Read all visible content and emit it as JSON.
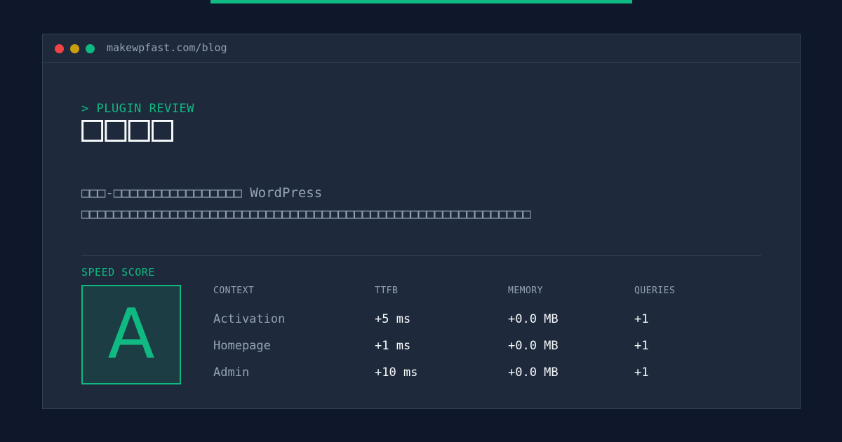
{
  "browser": {
    "url": "makewpfast.com/blog"
  },
  "article": {
    "kicker": "> PLUGIN REVIEW",
    "title": "□□□□",
    "description": "□□□-□□□□□□□□□□□□□□□□ WordPress □□□□□□□□□□□□□□□□□□□□□□□□□□□□□□□□□□□□□□□□□□□□□□□□□□□□□□□□"
  },
  "speed": {
    "label": "SPEED SCORE",
    "grade": "A"
  },
  "table": {
    "headers": [
      "CONTEXT",
      "TTFB",
      "MEMORY",
      "QUERIES"
    ],
    "rows": [
      [
        "Activation",
        "+5 ms",
        "+0.0 MB",
        "+1"
      ],
      [
        "Homepage",
        "+1 ms",
        "+0.0 MB",
        "+1"
      ],
      [
        "Admin",
        "+10 ms",
        "+0.0 MB",
        "+1"
      ]
    ]
  },
  "colors": {
    "background": "#0f172a",
    "card": "#1e293b",
    "accent": "#10b981",
    "text": "#f8fafc",
    "muted": "#94a3b8",
    "dot_red": "#ef4444",
    "dot_yellow": "#eab308",
    "dot_green": "#10b981"
  }
}
